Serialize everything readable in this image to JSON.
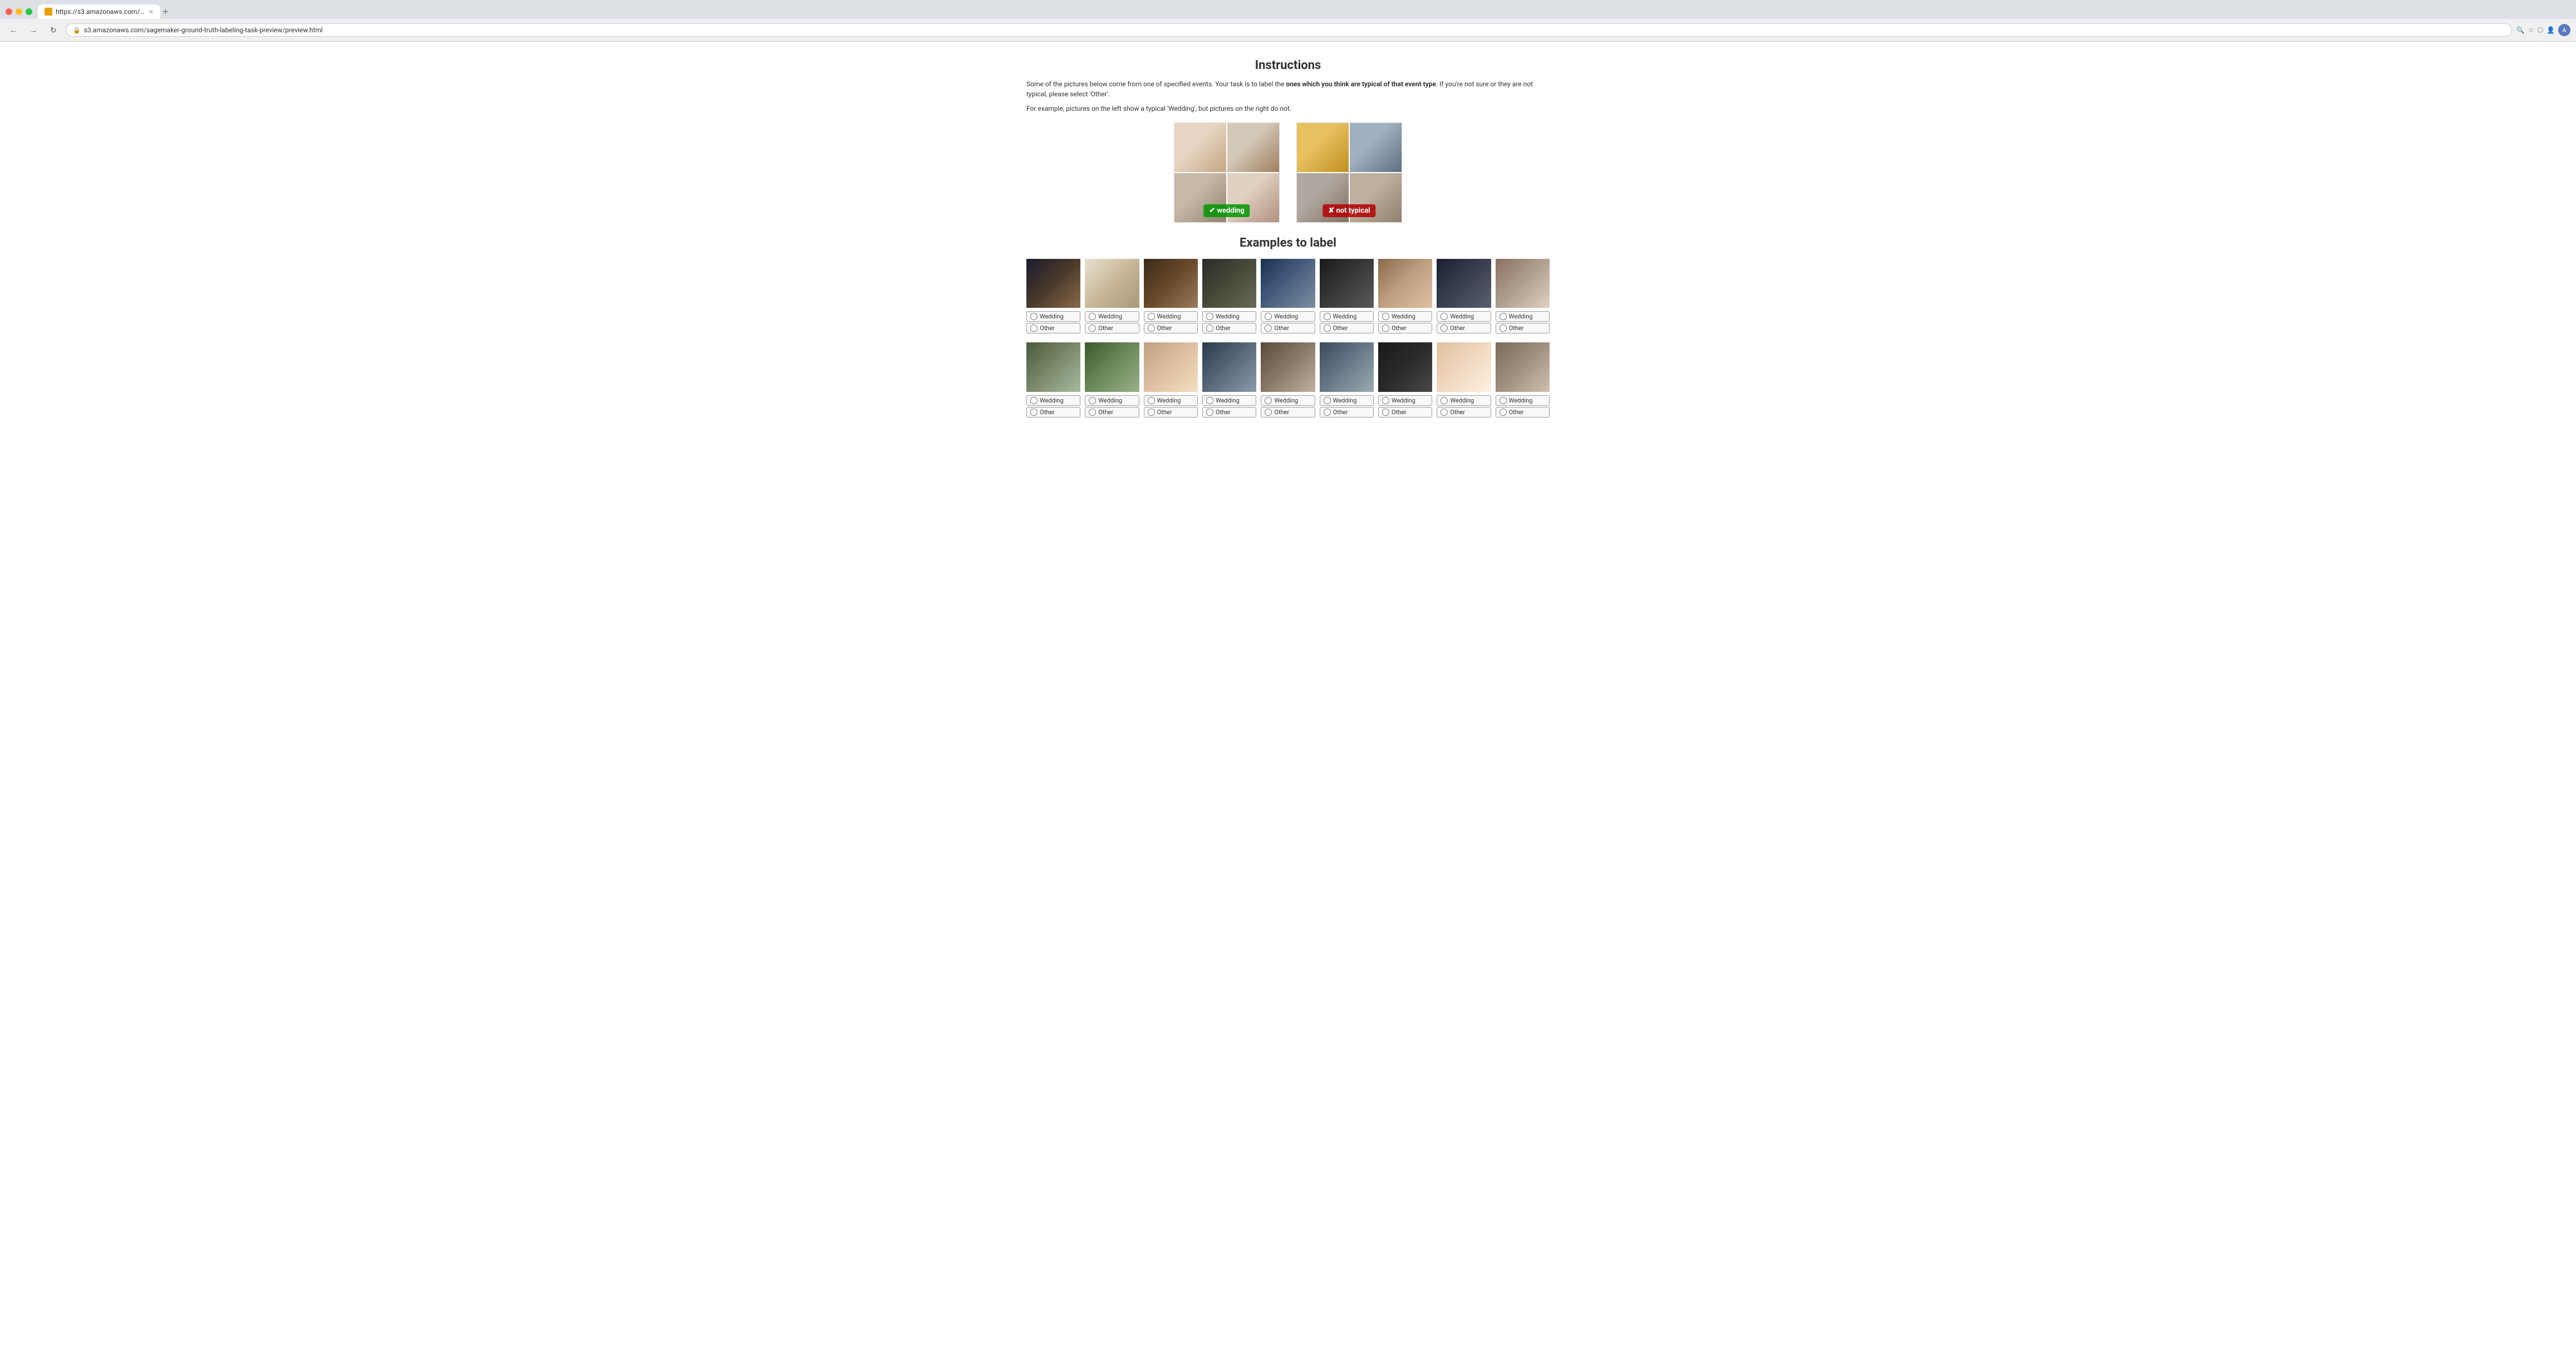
{
  "browser": {
    "url": "s3.amazonaws.com/sagemaker-ground-truth-labeling-task-preview/preview.html",
    "tab_title": "https://s3.amazonaws.com/s...",
    "new_tab_label": "+",
    "nav": {
      "back": "←",
      "forward": "→",
      "refresh": "↻"
    }
  },
  "page": {
    "title": "Instructions",
    "instructions_line1": "Some of the pictures below come from one of specified events. Your task is to label the ",
    "instructions_bold": "ones which you think are typical of that event type",
    "instructions_line1_end": ". If you're not sure or they are not typical, please select 'Other'.",
    "instructions_line2": "For example, pictures on the left show a typical 'Wedding', but pictures on the right do not.",
    "examples_label_wedding": "✔ wedding",
    "examples_label_not_typical": "✘ not typical",
    "examples_to_label_title": "Examples to label",
    "wedding_label": "Wedding",
    "other_label": "Other"
  },
  "image_rows": [
    {
      "images": [
        {
          "id": 1,
          "color": "c1"
        },
        {
          "id": 2,
          "color": "c2"
        },
        {
          "id": 3,
          "color": "c3"
        },
        {
          "id": 4,
          "color": "c4"
        },
        {
          "id": 5,
          "color": "c5"
        },
        {
          "id": 6,
          "color": "c6"
        },
        {
          "id": 7,
          "color": "c7"
        },
        {
          "id": 8,
          "color": "c13"
        },
        {
          "id": 9,
          "color": "c14"
        }
      ]
    },
    {
      "images": [
        {
          "id": 10,
          "color": "c8"
        },
        {
          "id": 11,
          "color": "c10"
        },
        {
          "id": 12,
          "color": "c15"
        },
        {
          "id": 13,
          "color": "c16"
        },
        {
          "id": 14,
          "color": "c9"
        },
        {
          "id": 15,
          "color": "c11"
        },
        {
          "id": 16,
          "color": "c17"
        },
        {
          "id": 17,
          "color": "c18"
        },
        {
          "id": 18,
          "color": "c12"
        }
      ]
    }
  ]
}
